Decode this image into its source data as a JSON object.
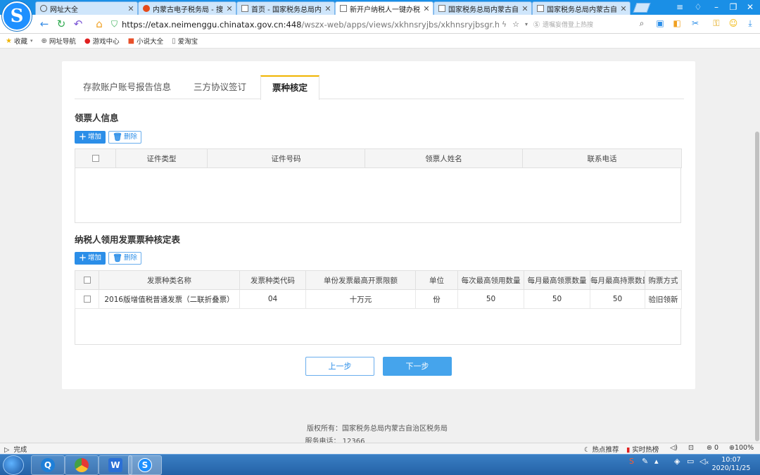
{
  "browser": {
    "tabs": [
      {
        "title": "网址大全",
        "icon": "globe-icon",
        "active": false
      },
      {
        "title": "内蒙古电子税务局 - 搜狗",
        "icon": "sogou-icon",
        "active": false
      },
      {
        "title": "首页 - 国家税务总局内蒙",
        "icon": "document-icon",
        "active": false
      },
      {
        "title": "新开户纳税人一键办税 -",
        "icon": "document-icon",
        "active": true
      },
      {
        "title": "国家税务总局内蒙古自治",
        "icon": "document-icon",
        "active": false
      },
      {
        "title": "国家税务总局内蒙古自治",
        "icon": "document-icon",
        "active": false
      }
    ],
    "url_host": "https://etax.neimenggu.chinatax.gov.cn:448",
    "url_path": "/wszx-web/apps/views/xkhnsryjbs/xkhnsryjbsgr.html?code",
    "search_placeholder": "遗嘱妄借登上热搜",
    "bookmarks": [
      {
        "label": "收藏",
        "icon": "star-icon"
      },
      {
        "label": "网址导航",
        "icon": "globe-icon"
      },
      {
        "label": "游戏中心",
        "icon": "game-icon"
      },
      {
        "label": "小说大全",
        "icon": "book-icon"
      },
      {
        "label": "爱淘宝",
        "icon": "document-icon"
      }
    ]
  },
  "page": {
    "tabs": [
      {
        "label": "存款账户账号报告信息",
        "active": false
      },
      {
        "label": "三方协议签订",
        "active": false
      },
      {
        "label": "票种核定",
        "active": true
      }
    ],
    "section1": {
      "title": "领票人信息",
      "add_label": "增加",
      "delete_label": "删除",
      "columns": [
        "证件类型",
        "证件号码",
        "领票人姓名",
        "联系电话"
      ]
    },
    "section2": {
      "title": "纳税人领用发票票种核定表",
      "add_label": "增加",
      "delete_label": "删除",
      "columns": [
        "发票种类名称",
        "发票种类代码",
        "单份发票最高开票限额",
        "单位",
        "每次最高领用数量",
        "每月最高领票数量",
        "每月最高持票数量",
        "购票方式"
      ],
      "rows": [
        [
          "2016版增值税普通发票（二联折叠票）",
          "04",
          "十万元",
          "份",
          "50",
          "50",
          "50",
          "验旧领新"
        ]
      ]
    },
    "prev_label": "上一步",
    "next_label": "下一步",
    "copyright": "版权所有：国家税务总局内蒙古自治区税务局",
    "service_phone": "服务电话： 12366"
  },
  "statusbar": {
    "status": "完成",
    "hot": "热点推荐",
    "realtime": "实时热榜",
    "count": "0",
    "zoom": "100%"
  },
  "taskbar": {
    "time": "10:07",
    "date": "2020/11/25"
  },
  "colors": {
    "accent": "#2b8ee8",
    "active_tab_border": "#f0b400",
    "tabstrip": "#1a8fe6"
  }
}
